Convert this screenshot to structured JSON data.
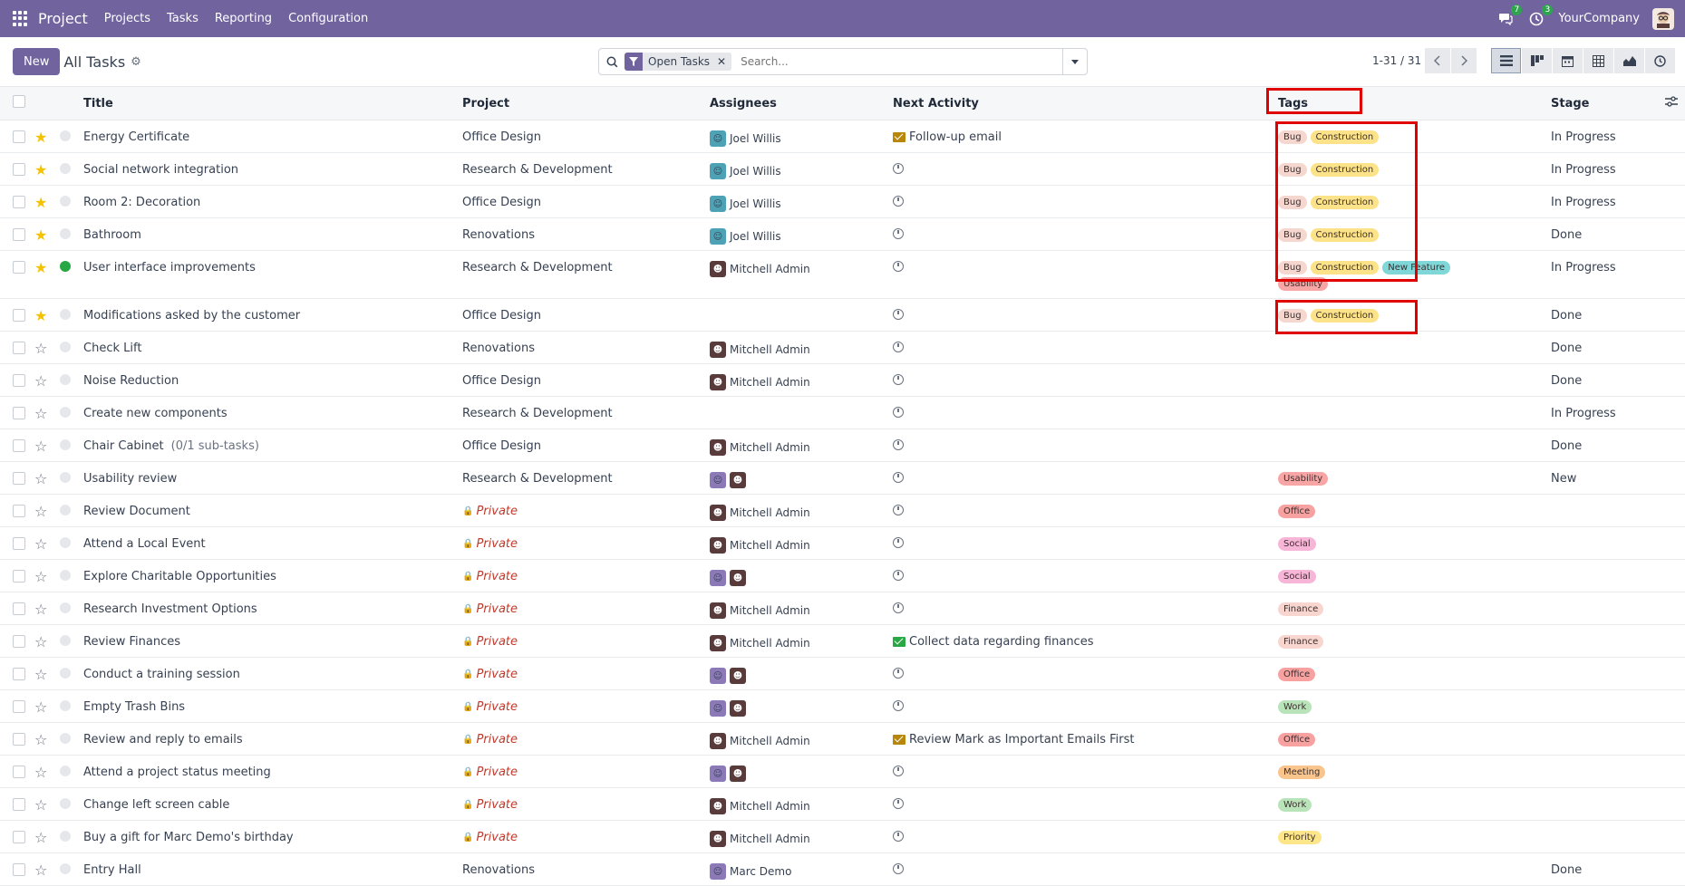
{
  "navbar": {
    "brand": "Project",
    "menus": [
      "Projects",
      "Tasks",
      "Reporting",
      "Configuration"
    ],
    "messages_count": "7",
    "activities_count": "3",
    "company": "YourCompany"
  },
  "control": {
    "new_label": "New",
    "breadcrumb": "All Tasks",
    "facet_value": "Open Tasks",
    "search_placeholder": "Search...",
    "pager": "1-31 / 31"
  },
  "columns": {
    "title": "Title",
    "project": "Project",
    "assignees": "Assignees",
    "activity": "Next Activity",
    "tags": "Tags",
    "stage": "Stage"
  },
  "rows": [
    {
      "title": "Energy Certificate",
      "subtasks": "",
      "starred": true,
      "status": "",
      "project": "Office Design",
      "private": false,
      "assignees": "Joel Willis",
      "avatars": [
        "joel"
      ],
      "activity": "Follow-up email",
      "activity_type": "mail-orange",
      "tags": [
        "Bug",
        "Construction"
      ],
      "stage": "In Progress"
    },
    {
      "title": "Social network integration",
      "subtasks": "",
      "starred": true,
      "status": "",
      "project": "Research & Development",
      "private": false,
      "assignees": "Joel Willis",
      "avatars": [
        "joel"
      ],
      "activity": "",
      "activity_type": "clock",
      "tags": [
        "Bug",
        "Construction"
      ],
      "stage": "In Progress"
    },
    {
      "title": "Room 2: Decoration",
      "subtasks": "",
      "starred": true,
      "status": "",
      "project": "Office Design",
      "private": false,
      "assignees": "Joel Willis",
      "avatars": [
        "joel"
      ],
      "activity": "",
      "activity_type": "clock",
      "tags": [
        "Bug",
        "Construction"
      ],
      "stage": "In Progress"
    },
    {
      "title": "Bathroom",
      "subtasks": "",
      "starred": true,
      "status": "",
      "project": "Renovations",
      "private": false,
      "assignees": "Joel Willis",
      "avatars": [
        "joel"
      ],
      "activity": "",
      "activity_type": "clock",
      "tags": [
        "Bug",
        "Construction"
      ],
      "stage": "Done"
    },
    {
      "title": "User interface improvements",
      "subtasks": "",
      "starred": true,
      "status": "green",
      "project": "Research & Development",
      "private": false,
      "assignees": "Mitchell Admin",
      "avatars": [
        "admin"
      ],
      "activity": "",
      "activity_type": "clock",
      "tags": [
        "Bug",
        "Construction",
        "New Feature",
        "Usability"
      ],
      "stage": "In Progress"
    },
    {
      "title": "Modifications asked by the customer",
      "subtasks": "",
      "starred": true,
      "status": "",
      "project": "Office Design",
      "private": false,
      "assignees": "",
      "avatars": [],
      "activity": "",
      "activity_type": "clock",
      "tags": [
        "Bug",
        "Construction"
      ],
      "stage": "Done"
    },
    {
      "title": "Check Lift",
      "subtasks": "",
      "starred": false,
      "status": "",
      "project": "Renovations",
      "private": false,
      "assignees": "Mitchell Admin",
      "avatars": [
        "admin"
      ],
      "activity": "",
      "activity_type": "clock",
      "tags": [],
      "stage": "Done"
    },
    {
      "title": "Noise Reduction",
      "subtasks": "",
      "starred": false,
      "status": "",
      "project": "Office Design",
      "private": false,
      "assignees": "Mitchell Admin",
      "avatars": [
        "admin"
      ],
      "activity": "",
      "activity_type": "clock",
      "tags": [],
      "stage": "Done"
    },
    {
      "title": "Create new components",
      "subtasks": "",
      "starred": false,
      "status": "",
      "project": "Research & Development",
      "private": false,
      "assignees": "",
      "avatars": [],
      "activity": "",
      "activity_type": "clock",
      "tags": [],
      "stage": "In Progress"
    },
    {
      "title": "Chair Cabinet",
      "subtasks": "(0/1 sub-tasks)",
      "starred": false,
      "status": "",
      "project": "Office Design",
      "private": false,
      "assignees": "Mitchell Admin",
      "avatars": [
        "admin"
      ],
      "activity": "",
      "activity_type": "clock",
      "tags": [],
      "stage": "Done"
    },
    {
      "title": "Usability review",
      "subtasks": "",
      "starred": false,
      "status": "",
      "project": "Research & Development",
      "private": false,
      "assignees": "",
      "avatars": [
        "demo",
        "admin"
      ],
      "activity": "",
      "activity_type": "clock",
      "tags": [
        "Usability"
      ],
      "stage": "New"
    },
    {
      "title": "Review Document",
      "subtasks": "",
      "starred": false,
      "status": "",
      "project": "Private",
      "private": true,
      "assignees": "Mitchell Admin",
      "avatars": [
        "admin"
      ],
      "activity": "",
      "activity_type": "clock",
      "tags": [
        "Office"
      ],
      "stage": ""
    },
    {
      "title": "Attend a Local Event",
      "subtasks": "",
      "starred": false,
      "status": "",
      "project": "Private",
      "private": true,
      "assignees": "Mitchell Admin",
      "avatars": [
        "admin"
      ],
      "activity": "",
      "activity_type": "clock",
      "tags": [
        "Social"
      ],
      "stage": ""
    },
    {
      "title": "Explore Charitable Opportunities",
      "subtasks": "",
      "starred": false,
      "status": "",
      "project": "Private",
      "private": true,
      "assignees": "",
      "avatars": [
        "demo",
        "admin"
      ],
      "activity": "",
      "activity_type": "clock",
      "tags": [
        "Social"
      ],
      "stage": ""
    },
    {
      "title": "Research Investment Options",
      "subtasks": "",
      "starred": false,
      "status": "",
      "project": "Private",
      "private": true,
      "assignees": "Mitchell Admin",
      "avatars": [
        "admin"
      ],
      "activity": "",
      "activity_type": "clock",
      "tags": [
        "Finance"
      ],
      "stage": ""
    },
    {
      "title": "Review Finances",
      "subtasks": "",
      "starred": false,
      "status": "",
      "project": "Private",
      "private": true,
      "assignees": "Mitchell Admin",
      "avatars": [
        "admin"
      ],
      "activity": "Collect data regarding finances",
      "activity_type": "mail-green",
      "tags": [
        "Finance"
      ],
      "stage": ""
    },
    {
      "title": "Conduct a training session",
      "subtasks": "",
      "starred": false,
      "status": "",
      "project": "Private",
      "private": true,
      "assignees": "",
      "avatars": [
        "demo",
        "admin"
      ],
      "activity": "",
      "activity_type": "clock",
      "tags": [
        "Office"
      ],
      "stage": ""
    },
    {
      "title": "Empty Trash Bins",
      "subtasks": "",
      "starred": false,
      "status": "",
      "project": "Private",
      "private": true,
      "assignees": "",
      "avatars": [
        "demo",
        "admin"
      ],
      "activity": "",
      "activity_type": "clock",
      "tags": [
        "Work"
      ],
      "stage": ""
    },
    {
      "title": "Review and reply to emails",
      "subtasks": "",
      "starred": false,
      "status": "",
      "project": "Private",
      "private": true,
      "assignees": "Mitchell Admin",
      "avatars": [
        "admin"
      ],
      "activity": "Review Mark as Important Emails First",
      "activity_type": "mail-orange",
      "tags": [
        "Office"
      ],
      "stage": ""
    },
    {
      "title": "Attend a project status meeting",
      "subtasks": "",
      "starred": false,
      "status": "",
      "project": "Private",
      "private": true,
      "assignees": "",
      "avatars": [
        "demo",
        "admin"
      ],
      "activity": "",
      "activity_type": "clock",
      "tags": [
        "Meeting"
      ],
      "stage": ""
    },
    {
      "title": "Change left screen cable",
      "subtasks": "",
      "starred": false,
      "status": "",
      "project": "Private",
      "private": true,
      "assignees": "Mitchell Admin",
      "avatars": [
        "admin"
      ],
      "activity": "",
      "activity_type": "clock",
      "tags": [
        "Work"
      ],
      "stage": ""
    },
    {
      "title": "Buy a gift for Marc Demo's birthday",
      "subtasks": "",
      "starred": false,
      "status": "",
      "project": "Private",
      "private": true,
      "assignees": "Mitchell Admin",
      "avatars": [
        "admin"
      ],
      "activity": "",
      "activity_type": "clock",
      "tags": [
        "Priority"
      ],
      "stage": ""
    },
    {
      "title": "Entry Hall",
      "subtasks": "",
      "starred": false,
      "status": "",
      "project": "Renovations",
      "private": false,
      "assignees": "Marc Demo",
      "avatars": [
        "demo"
      ],
      "activity": "",
      "activity_type": "clock",
      "tags": [],
      "stage": "Done"
    }
  ],
  "tag_colors": {
    "Bug": "#f6d7cf",
    "Construction": "#fce38a",
    "New Feature": "#7fd7d7",
    "Usability": "#f8a5a5",
    "Office": "#f7a1a1",
    "Social": "#f7b6d8",
    "Finance": "#f8d6cf",
    "Work": "#b9e4b9",
    "Meeting": "#f9c58c",
    "Priority": "#fde68a"
  },
  "accent_color": "#71639e",
  "highlight_color": "#e00000"
}
